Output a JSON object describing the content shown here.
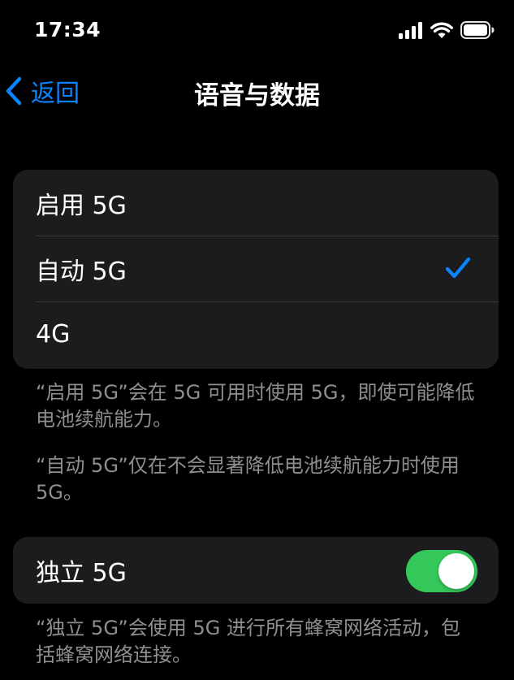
{
  "status_bar": {
    "time": "17:34",
    "icons": [
      "cellular-signal-icon",
      "wifi-icon",
      "battery-icon"
    ]
  },
  "nav": {
    "back_label": "返回",
    "title": "语音与数据"
  },
  "network_options": {
    "items": [
      {
        "label": "启用 5G",
        "selected": false
      },
      {
        "label": "自动 5G",
        "selected": true
      },
      {
        "label": "4G",
        "selected": false
      }
    ]
  },
  "footer": {
    "enable_5g_note": "“启用 5G”会在 5G 可用时使用 5G，即使可能降低电池续航能力。",
    "auto_5g_note": "“自动 5G”仅在不会显著降低电池续航能力时使用 5G。",
    "standalone_note": "“独立 5G”会使用 5G 进行所有蜂窝网络活动，包括蜂窝网络连接。"
  },
  "standalone_5g": {
    "label": "独立 5G",
    "enabled": true
  },
  "colors": {
    "accent": "#0a84ff",
    "toggle_on": "#34c759",
    "cell_background": "#1c1c1e",
    "footer_text": "#8e8e93"
  }
}
